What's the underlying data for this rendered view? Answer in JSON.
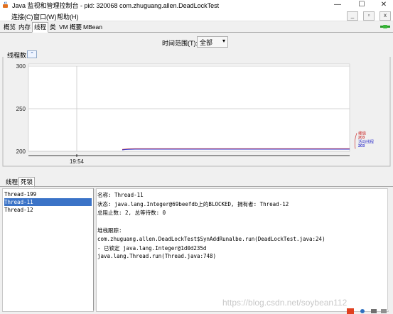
{
  "window": {
    "title": "Java 监视和管理控制台 - pid: 320068 com.zhuguang.allen.DeadLockTest",
    "minimize_glyph": "—",
    "maximize_glyph": "☐",
    "close_glyph": "✕"
  },
  "menubar": {
    "items": [
      "连接(C)",
      "窗口(W)",
      "帮助(H)"
    ],
    "mdi_buttons": [
      "_",
      "▫",
      "x"
    ]
  },
  "tabs": [
    "概览",
    "内存",
    "线程",
    "类",
    "VM 概要",
    "MBean"
  ],
  "active_tab": "线程",
  "time_range": {
    "label": "时间范围(T):",
    "value": "全部",
    "arrow": "▾"
  },
  "chart_panel": {
    "title": "线程数",
    "collapse_glyph": "⌃"
  },
  "chart_data": {
    "type": "line",
    "x": [
      "19:54"
    ],
    "yticks": [
      200,
      250,
      300
    ],
    "ylim": [
      200,
      300
    ],
    "grid": true,
    "legend_position": "right",
    "series": [
      {
        "name": "峰值",
        "color": "#cc3333",
        "value": 203
      },
      {
        "name": "活动线程",
        "color": "#3333cc",
        "value": 203
      }
    ]
  },
  "lower_tabs": [
    "线程",
    "死锁"
  ],
  "active_lower_tab": "死锁",
  "threads": [
    {
      "name": "Thread-199",
      "selected": false
    },
    {
      "name": "Thread-11",
      "selected": true
    },
    {
      "name": "Thread-12",
      "selected": false
    }
  ],
  "details": {
    "name_line": "名称: Thread-11",
    "state_line": "状态: java.lang.Integer@69beefdb上的BLOCKED, 拥有者: Thread-12",
    "blocked_line": "总阻止数: 2, 总等待数: 0",
    "trace_header": "堆栈跟踪:",
    "trace_1": "com.zhuguang.allen.DeadLockTest$SynAddRunalbe.run(DeadLockTest.java:24)",
    "trace_locked": "   - 已锁定 java.lang.Integer@1d0d235d",
    "trace_2": "java.lang.Thread.run(Thread.java:748)"
  },
  "watermark": "https://blog.csdn.net/soybean112"
}
